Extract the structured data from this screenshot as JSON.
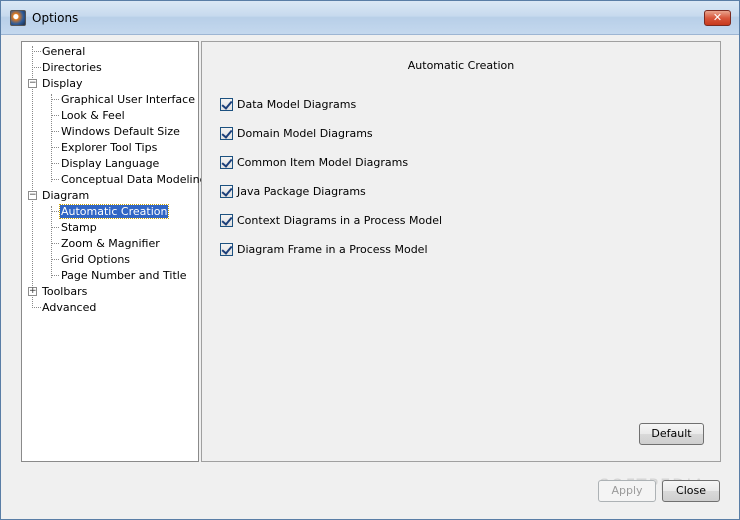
{
  "window": {
    "title": "Options",
    "close_glyph": "✕"
  },
  "nav": {
    "general": "General",
    "directories": "Directories",
    "display": "Display",
    "display_children": [
      "Graphical User Interface",
      "Look & Feel",
      "Windows Default Size",
      "Explorer Tool Tips",
      "Display Language",
      "Conceptual Data Modeling"
    ],
    "diagram": "Diagram",
    "diagram_children": [
      "Automatic Creation",
      "Stamp",
      "Zoom & Magnifier",
      "Grid Options",
      "Page Number and Title"
    ],
    "toolbars": "Toolbars",
    "advanced": "Advanced",
    "selected": "Automatic Creation",
    "expander_open": "−",
    "expander_closed": "+"
  },
  "content": {
    "title": "Automatic Creation",
    "options": [
      {
        "label": "Data Model Diagrams",
        "checked": true
      },
      {
        "label": "Domain Model Diagrams",
        "checked": true
      },
      {
        "label": "Common Item Model Diagrams",
        "checked": true
      },
      {
        "label": "Java Package Diagrams",
        "checked": true
      },
      {
        "label": "Context Diagrams in a Process Model",
        "checked": true
      },
      {
        "label": "Diagram Frame in a Process Model",
        "checked": true
      }
    ],
    "default_label": "Default"
  },
  "footer": {
    "apply_label": "Apply",
    "close_label": "Close"
  },
  "watermark": "SOFTPEDIA",
  "icons": {
    "app": "app-icon",
    "close": "close-icon",
    "check": "checkmark-icon"
  },
  "colors": {
    "selection": "#3166c5",
    "close_button": "#d8573c",
    "titlebar": "#c7daee"
  }
}
